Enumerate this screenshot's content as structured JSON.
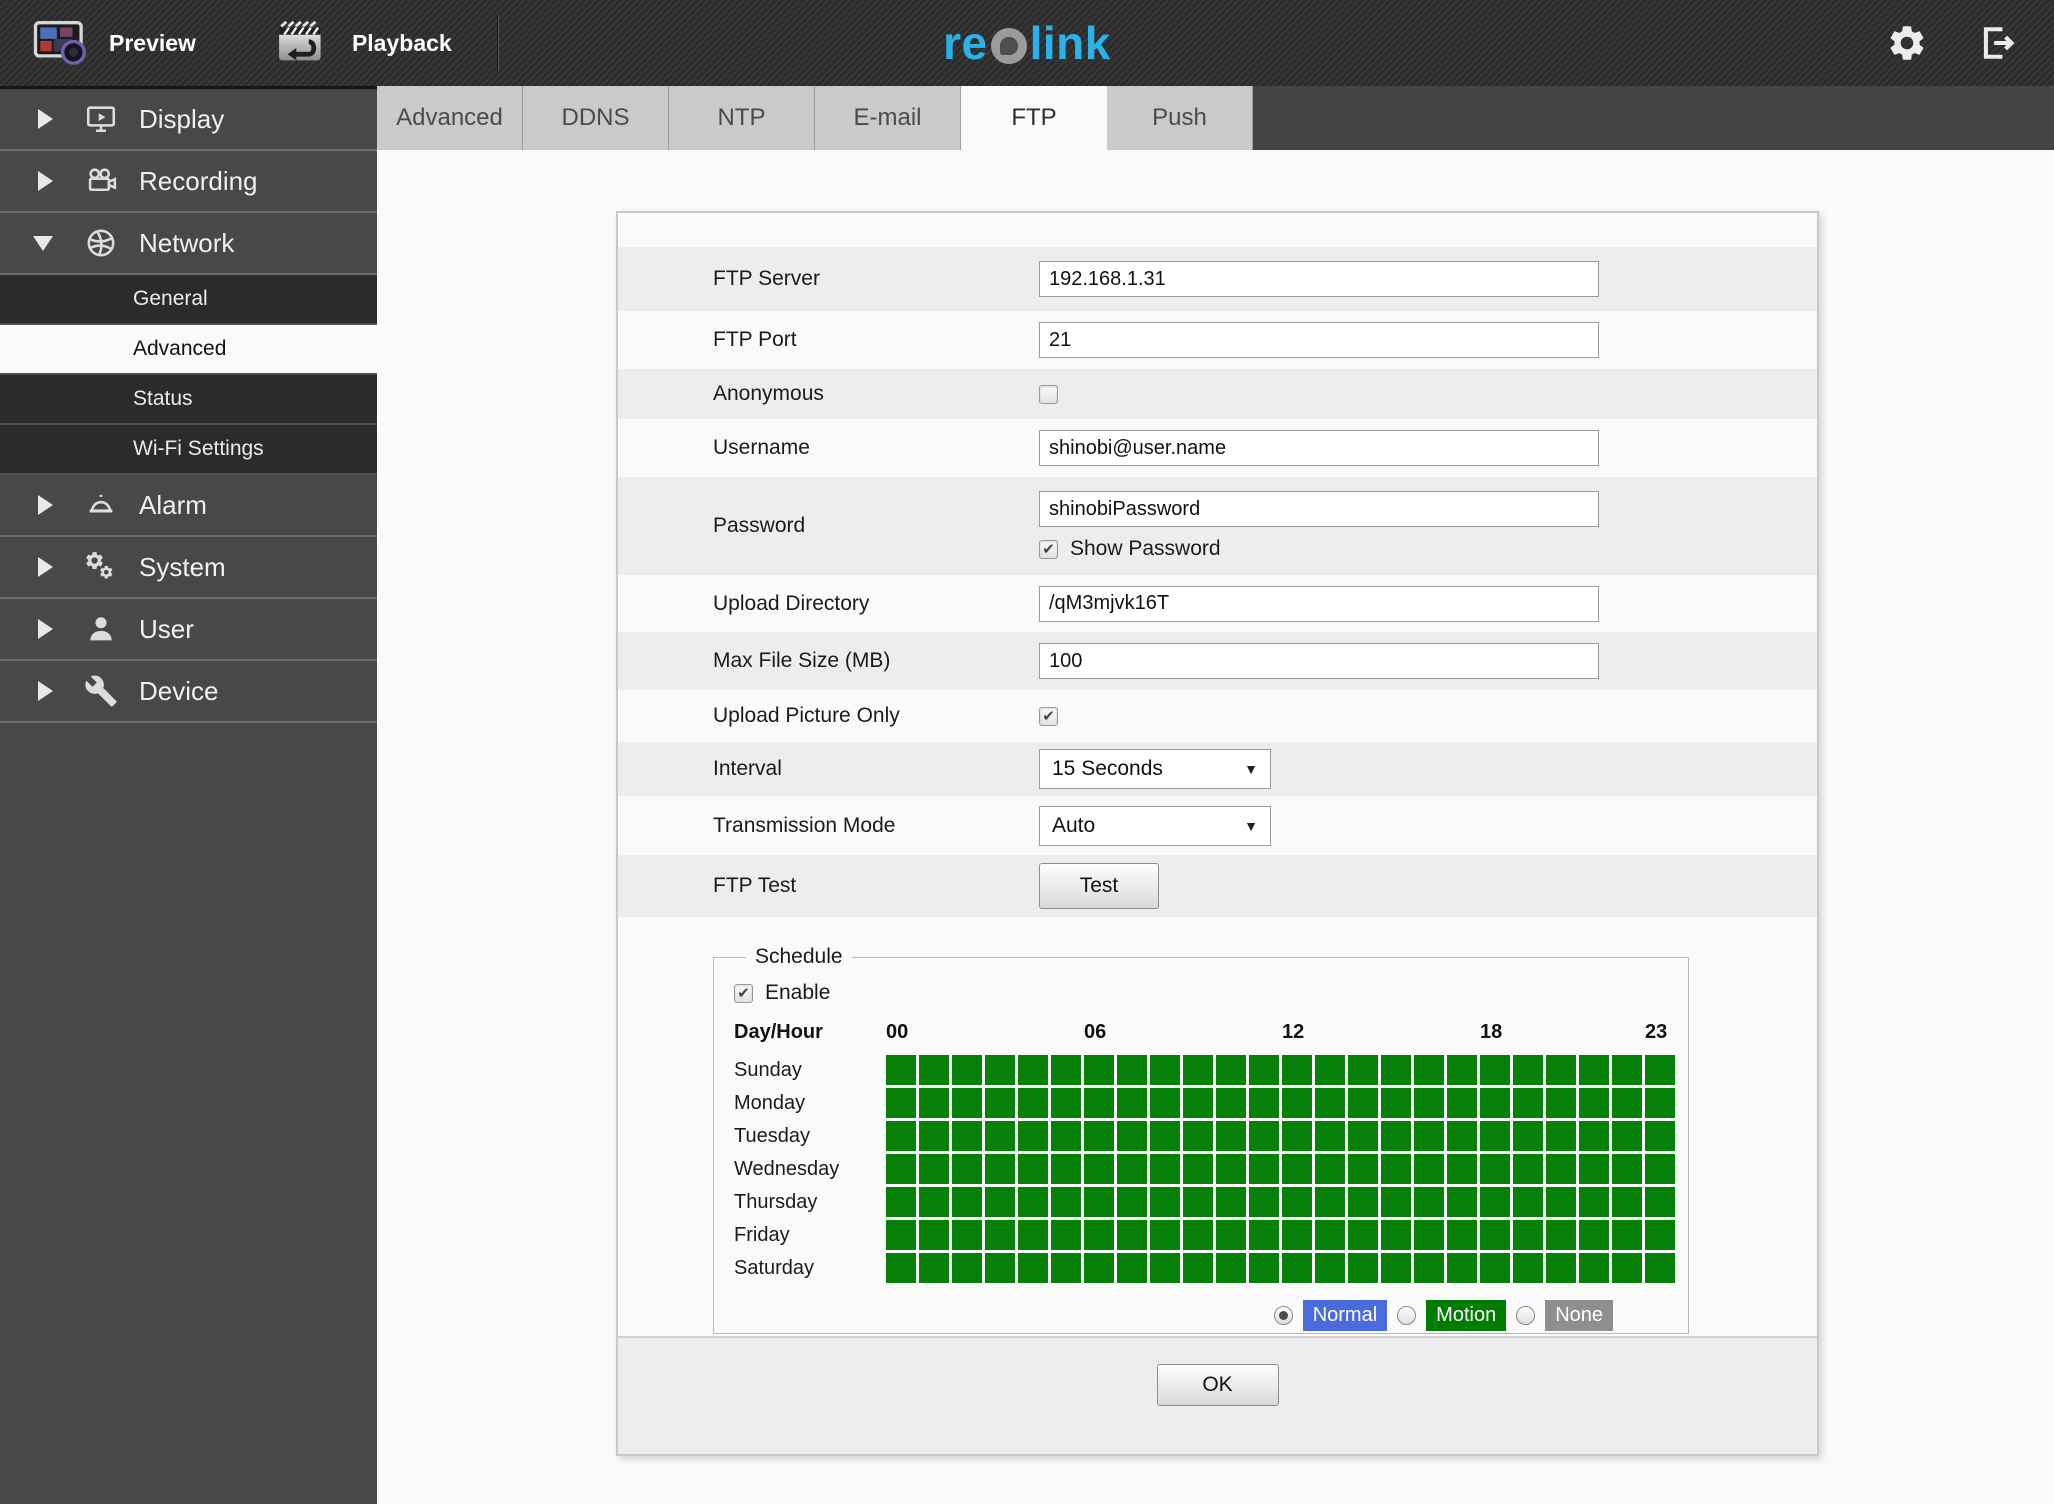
{
  "topbar": {
    "preview_label": "Preview",
    "playback_label": "Playback",
    "logo_re": "re",
    "logo_link": "link"
  },
  "sidebar": {
    "display": "Display",
    "recording": "Recording",
    "network": "Network",
    "general": "General",
    "advanced": "Advanced",
    "status": "Status",
    "wifi": "Wi-Fi Settings",
    "alarm": "Alarm",
    "system": "System",
    "user": "User",
    "device": "Device",
    "selected_item": "Advanced"
  },
  "tabs": {
    "advanced": "Advanced",
    "ddns": "DDNS",
    "ntp": "NTP",
    "email": "E-mail",
    "ftp": "FTP",
    "push": "Push",
    "active": "FTP"
  },
  "form": {
    "ftp_server": {
      "label": "FTP Server",
      "value": "192.168.1.31"
    },
    "ftp_port": {
      "label": "FTP Port",
      "value": "21"
    },
    "anonymous": {
      "label": "Anonymous",
      "checked": false
    },
    "username": {
      "label": "Username",
      "value": "shinobi@user.name"
    },
    "password": {
      "label": "Password",
      "value": "shinobiPassword",
      "show_password_label": "Show Password",
      "show_password_checked": true
    },
    "upload_directory": {
      "label": "Upload Directory",
      "value": "/qM3mjvk16T"
    },
    "max_file_size": {
      "label": "Max File Size (MB)",
      "value": "100"
    },
    "upload_picture_only": {
      "label": "Upload Picture Only",
      "checked": true
    },
    "interval": {
      "label": "Interval",
      "value": "15 Seconds"
    },
    "transmission_mode": {
      "label": "Transmission Mode",
      "value": "Auto"
    },
    "ftp_test": {
      "label": "FTP Test",
      "button": "Test"
    }
  },
  "schedule": {
    "legend": "Schedule",
    "enable_label": "Enable",
    "enable_checked": true,
    "day_hour_label": "Day/Hour",
    "hours": [
      {
        "label": "00",
        "col": 0
      },
      {
        "label": "06",
        "col": 6
      },
      {
        "label": "12",
        "col": 12
      },
      {
        "label": "18",
        "col": 18
      },
      {
        "label": "23",
        "col": 23
      }
    ],
    "days": [
      "Sunday",
      "Monday",
      "Tuesday",
      "Wednesday",
      "Thursday",
      "Friday",
      "Saturday"
    ],
    "grid": {
      "rows": 7,
      "cols": 24,
      "all_filled": true,
      "fill_color": "#078007"
    },
    "modes": [
      {
        "label": "Normal",
        "color": "#4a6bdb",
        "selected": true
      },
      {
        "label": "Motion",
        "color": "#007d00",
        "selected": false
      },
      {
        "label": "None",
        "color": "#8f8f8f",
        "selected": false
      }
    ]
  },
  "ok_label": "OK",
  "colors": {
    "brand_cyan": "#2ab3ea",
    "grid_green": "#078007",
    "normal_blue": "#4a6bdb",
    "motion_green": "#007d00",
    "none_gray": "#8f8f8f"
  }
}
